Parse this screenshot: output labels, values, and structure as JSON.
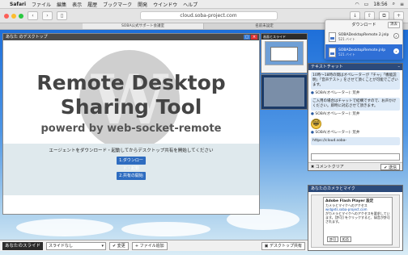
{
  "menubar": {
    "apple": "",
    "app": "Safari",
    "items": [
      "ファイル",
      "編集",
      "表示",
      "履歴",
      "ブックマーク",
      "開発",
      "ウインドウ",
      "ヘルプ"
    ],
    "clock": "18:56"
  },
  "browser": {
    "url": "cloud.soba-project.com",
    "tabs": [
      "SOBA公式サポート会議室",
      "名前未設定"
    ]
  },
  "share_window": {
    "title": "あなた のデスクトップ",
    "headline_1": "Remote Desktop",
    "headline_2": "Sharing Tool",
    "tagline": "powerd by web-socket-remote",
    "prompt": "エージェントをダウンロード・起動してからデスクトップ共有を開始してください",
    "download_button": "1.ダウンロード・起動",
    "start_button": "2.共有の開始"
  },
  "side_panel": {
    "title": "画面とスライド"
  },
  "chat": {
    "title": "テキストチャット",
    "messages": [
      {
        "text": "10時〜18時の間はオペレーターが「チャ」「機能説明」「音声テスト」をさせて頂くことが可能でございます。"
      },
      {
        "sender": "SOBA(オペレーター): 荒井",
        "text": "ご入用の場合はチャットで結構ですので、お声かけください。即時に対応させて頂きます。"
      },
      {
        "sender": "SOBA(オペレーター): 荒井",
        "emoji": "😀"
      },
      {
        "sender": "SOBA(オペレーター): 荒井",
        "text": "https://cloud.soba-"
      }
    ],
    "input_value": "",
    "clear_button": "コメントクリア",
    "send_button": "送信"
  },
  "camera_panel": {
    "title": "あなたのカメラとマイク",
    "flash_dialog": {
      "title": "Adobe Flash Player 設定",
      "line1": "カメラとマイクへのアクセス",
      "site": "widgets.soba-project.com",
      "line2": "がカメラとマイクへのアクセスを要求しています。[許可] をクリックすると、録音が許可されます。",
      "allow": "許可",
      "deny": "拒否"
    }
  },
  "bottom_bar": {
    "label": "あなたのスライド",
    "select_value": "スライドなし",
    "change_button": "変更",
    "add_file_button": "ファイル追加",
    "desktop_share_button": "デスクトップ共有"
  },
  "downloads": {
    "title": "ダウンロード",
    "clear": "消去",
    "items": [
      {
        "name": "SOBADesktopRemote 2.jnlp",
        "size": "521 バイト"
      },
      {
        "name": "SOBADesktopRemote.jnlp",
        "size": "521 バイト"
      }
    ]
  },
  "colors": {
    "accent": "#2e6cc0",
    "selected": "#2f6fd6"
  }
}
